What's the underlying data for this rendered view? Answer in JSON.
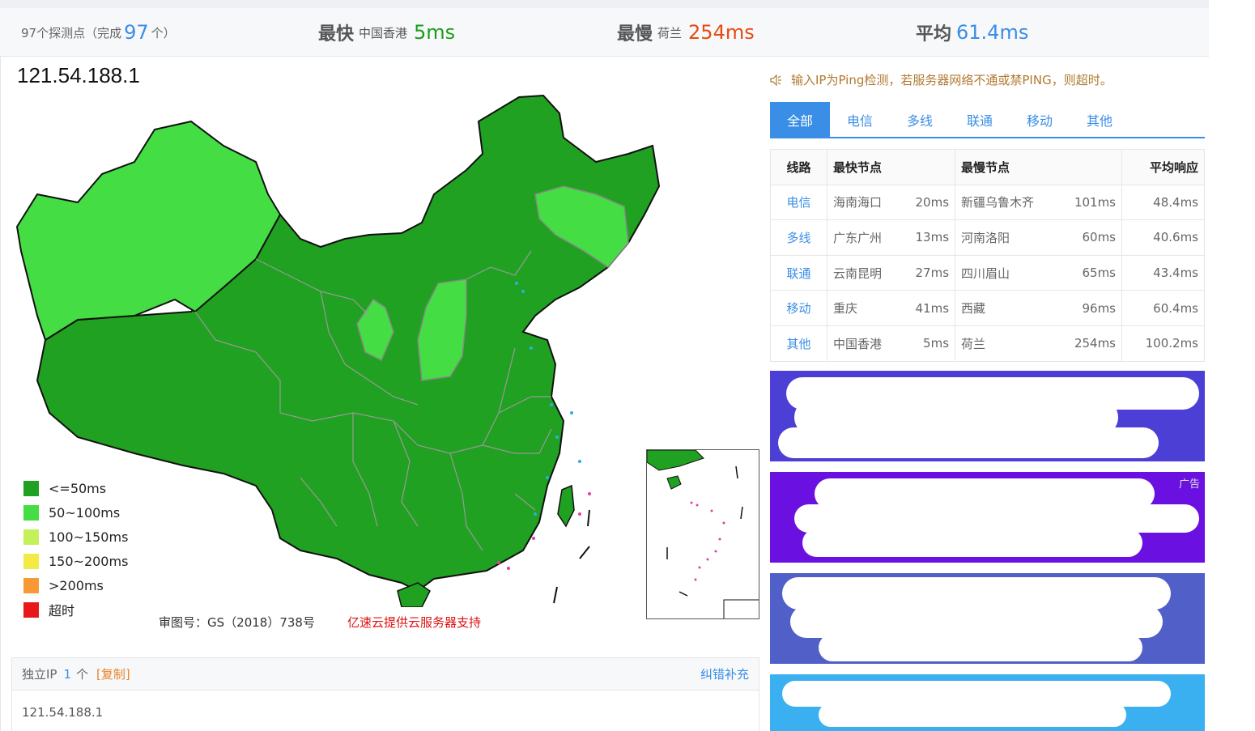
{
  "stats": {
    "probes_prefix": "97个探测点（完成",
    "probes_done": "97",
    "probes_suffix": "个）",
    "fastest_label": "最快",
    "fastest_loc": "中国香港",
    "fastest_val": "5ms",
    "slowest_label": "最慢",
    "slowest_loc": "荷兰",
    "slowest_val": "254ms",
    "avg_label": "平均",
    "avg_val": "61.4ms"
  },
  "target_ip": "121.54.188.1",
  "legend": [
    {
      "label": "<=50ms",
      "color": "#21a121"
    },
    {
      "label": "50~100ms",
      "color": "#44dd44"
    },
    {
      "label": "100~150ms",
      "color": "#c4f05a"
    },
    {
      "label": "150~200ms",
      "color": "#f2ea45"
    },
    {
      "label": ">200ms",
      "color": "#f79a35"
    },
    {
      "label": "超时",
      "color": "#e81919"
    }
  ],
  "map_labels": {
    "approval": "审图号：GS（2018）738号",
    "sponsor": "亿速云提供云服务器支持"
  },
  "ip_box": {
    "label": "独立IP",
    "count": "1",
    "unit": "个",
    "copy": "[复制]",
    "fix": "纠错补充",
    "ip": "121.54.188.1"
  },
  "notice": "输入IP为Ping检测，若服务器网络不通或禁PING，则超时。",
  "tabs": [
    "全部",
    "电信",
    "多线",
    "联通",
    "移动",
    "其他"
  ],
  "table": {
    "headers": {
      "line": "线路",
      "fastest": "最快节点",
      "slowest": "最慢节点",
      "avg": "平均响应"
    },
    "rows": [
      {
        "line": "电信",
        "fast_node": "海南海口",
        "fast_ms": "20ms",
        "slow_node": "新疆乌鲁木齐",
        "slow_ms": "101ms",
        "avg": "48.4ms"
      },
      {
        "line": "多线",
        "fast_node": "广东广州",
        "fast_ms": "13ms",
        "slow_node": "河南洛阳",
        "slow_ms": "60ms",
        "avg": "40.6ms"
      },
      {
        "line": "联通",
        "fast_node": "云南昆明",
        "fast_ms": "27ms",
        "slow_node": "四川眉山",
        "slow_ms": "65ms",
        "avg": "43.4ms"
      },
      {
        "line": "移动",
        "fast_node": "重庆",
        "fast_ms": "41ms",
        "slow_node": "西藏",
        "slow_ms": "96ms",
        "avg": "60.4ms"
      },
      {
        "line": "其他",
        "fast_node": "中国香港",
        "fast_ms": "5ms",
        "slow_node": "荷兰",
        "slow_ms": "254ms",
        "avg": "100.2ms"
      }
    ]
  },
  "ads": {
    "tag": "广告"
  },
  "colors": {
    "accent": "#3a8ee6",
    "fast": "#21a121",
    "medium": "#44dd44"
  }
}
